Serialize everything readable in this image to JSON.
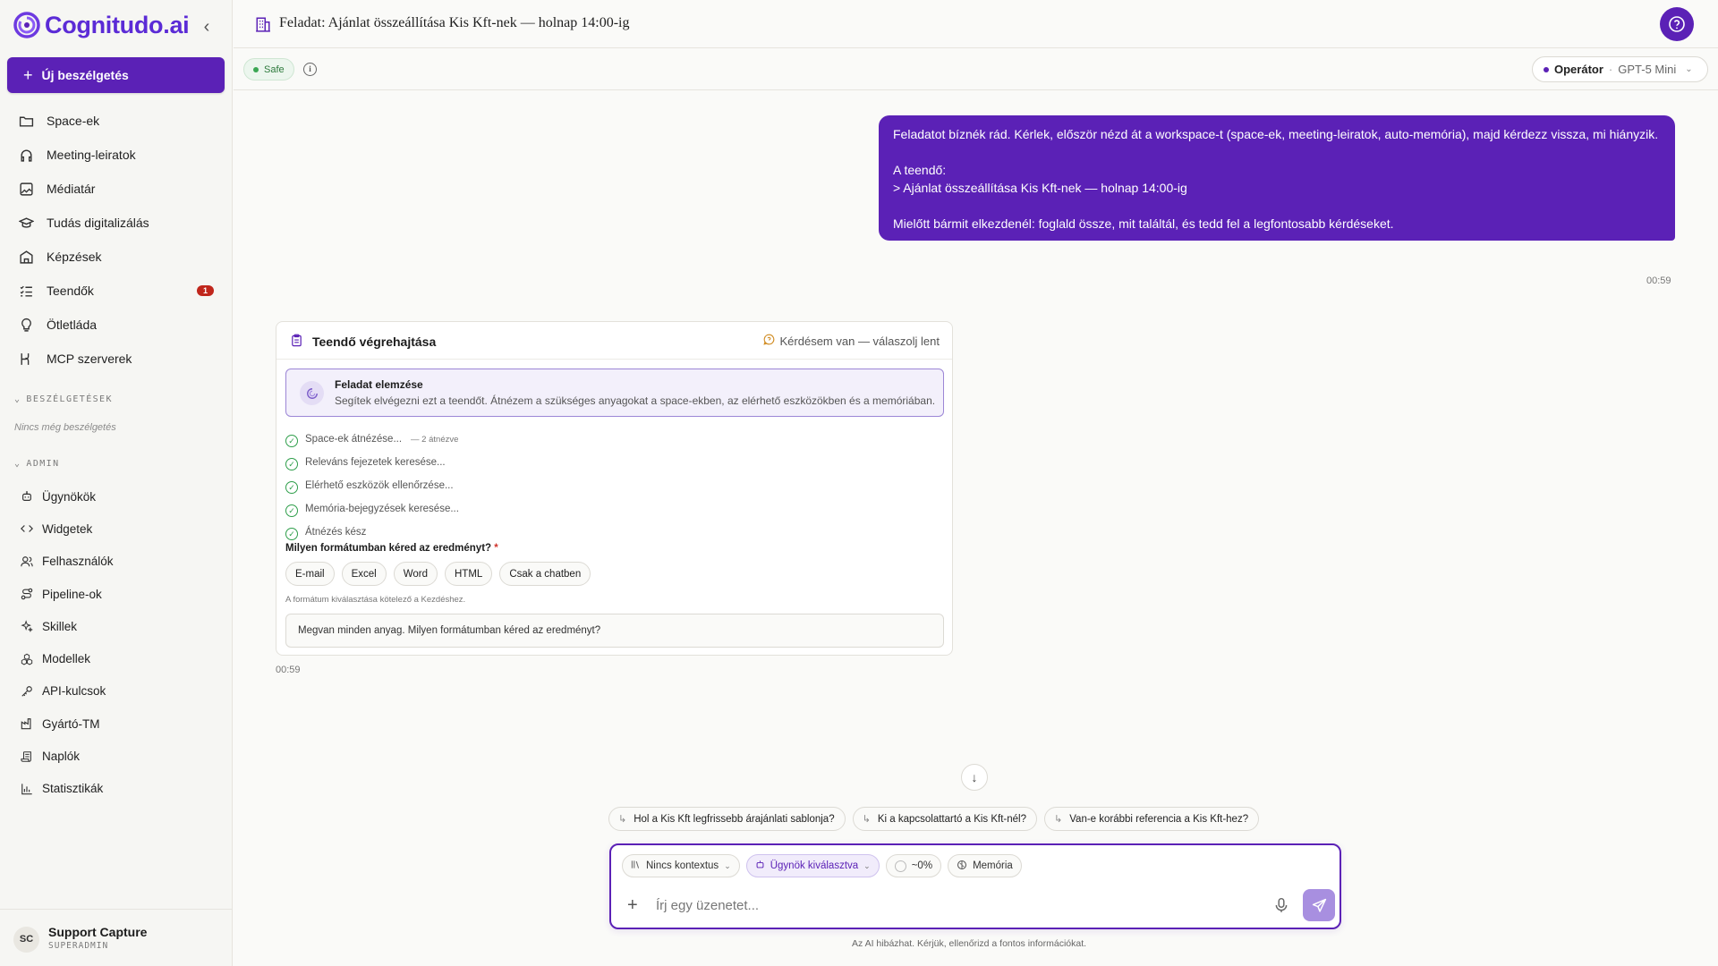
{
  "sidebar": {
    "logo_text": "Cognitudo.ai",
    "new_chat_label": "Új beszélgetés",
    "nav_items": [
      {
        "label": "Space-ek",
        "icon": "folder-icon"
      },
      {
        "label": "Meeting-leiratok",
        "icon": "headphones-icon"
      },
      {
        "label": "Médiatár",
        "icon": "image-gallery-icon"
      },
      {
        "label": "Tudás digitalizálás",
        "icon": "graduation-cap-icon"
      },
      {
        "label": "Képzések",
        "icon": "building-icon"
      },
      {
        "label": "Teendők",
        "icon": "list-check-icon",
        "badge": "1"
      },
      {
        "label": "Ötletláda",
        "icon": "lightbulb-icon"
      },
      {
        "label": "MCP szerverek",
        "icon": "plug-icon"
      }
    ],
    "conversations_label": "BESZÉLGETÉSEK",
    "no_conversations": "Nincs még beszélgetés",
    "admin_label": "ADMIN",
    "admin_items": [
      {
        "label": "Ügynökök",
        "icon": "bot-icon"
      },
      {
        "label": "Widgetek",
        "icon": "code-icon"
      },
      {
        "label": "Felhasználók",
        "icon": "users-icon"
      },
      {
        "label": "Pipeline-ok",
        "icon": "route-icon"
      },
      {
        "label": "Skillek",
        "icon": "sparkles-icon"
      },
      {
        "label": "Modellek",
        "icon": "cubes-icon"
      },
      {
        "label": "API-kulcsok",
        "icon": "key-icon"
      },
      {
        "label": "Gyártó-TM",
        "icon": "factory-icon"
      },
      {
        "label": "Naplók",
        "icon": "scroll-icon"
      },
      {
        "label": "Statisztikák",
        "icon": "bar-chart-icon"
      }
    ],
    "user": {
      "initials": "SC",
      "name": "Support Capture",
      "role": "SUPERADMIN"
    }
  },
  "header": {
    "title": "Feladat: Ajánlat összeállítása Kis Kft-nek — holnap 14:00-ig",
    "safe_label": "Safe",
    "mode_label": "Operátor",
    "model_label": "GPT-5 Mini"
  },
  "user_message": {
    "line1": "Feladatot bíznék rád. Kérlek, először nézd át a workspace-t (space-ek, meeting-leiratok, auto-memória), majd kérdezz vissza, mi hiányzik.",
    "line2": "A teendő:",
    "line3": "> Ajánlat összeállítása Kis Kft-nek — holnap 14:00-ig",
    "line4": "Mielőtt bármit elkezdenél: foglald össze, mit találtál, és tedd fel a legfontosabb kérdéseket.",
    "time": "00:59"
  },
  "task_card": {
    "title": "Teendő végrehajtása",
    "status": "Kérdésem van — válaszolj lent",
    "analysis_title": "Feladat elemzése",
    "analysis_desc": "Segítek elvégezni ezt a teendőt. Átnézem a szükséges anyagokat a space-ekben, az elérhető eszközökben és a memóriában.",
    "steps": [
      {
        "label": "Space-ek átnézése...",
        "meta": "— 2 átnézve"
      },
      {
        "label": "Releváns fejezetek keresése...",
        "meta": ""
      },
      {
        "label": "Elérhető eszközök ellenőrzése...",
        "meta": ""
      },
      {
        "label": "Memória-bejegyzések keresése...",
        "meta": ""
      },
      {
        "label": "Átnézés kész",
        "meta": ""
      }
    ],
    "format_question": "Milyen formátumban kéred az eredményt?",
    "required_mark": "*",
    "formats": [
      "E-mail",
      "Excel",
      "Word",
      "HTML",
      "Csak a chatben"
    ],
    "format_note": "A formátum kiválasztása kötelező a Kezdéshez.",
    "input_value": "Megvan minden anyag. Milyen formátumban kéred az eredményt?",
    "time": "00:59"
  },
  "suggestions": [
    "Hol a Kis Kft legfrissebb árajánlati sablonja?",
    "Ki a kapcsolattartó a Kis Kft-nél?",
    "Van-e korábbi referencia a Kis Kft-hez?"
  ],
  "composer": {
    "context_chip": "Nincs kontextus",
    "agent_chip": "Ügynök kiválasztva",
    "usage_chip": "~0%",
    "memory_chip": "Memória",
    "placeholder": "Írj egy üzenetet...",
    "disclaimer": "Az AI hibázhat. Kérjük, ellenőrizd a fontos információkat."
  },
  "colors": {
    "accent": "#5b21b6",
    "badge": "#c0261b",
    "safe": "#2d7a3c"
  }
}
